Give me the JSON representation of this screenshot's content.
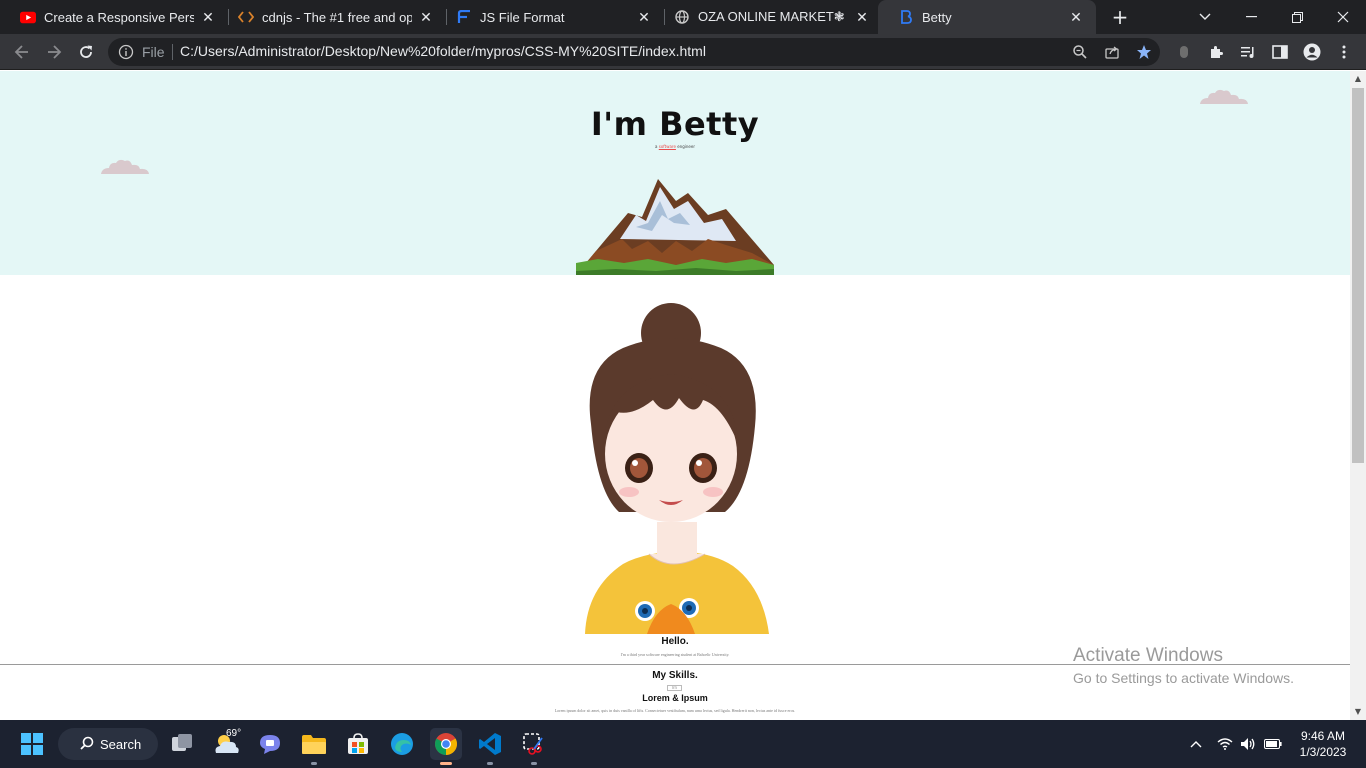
{
  "browser": {
    "tabs": [
      {
        "title": "Create a Responsive Personal",
        "favicon": "youtube-icon",
        "active": false
      },
      {
        "title": "cdnjs - The #1 free and open",
        "favicon": "code-brackets-icon",
        "active": false
      },
      {
        "title": "JS File Format",
        "favicon": "f-logo-icon",
        "active": false
      },
      {
        "title": "OZA ONLINE MARKET❃",
        "favicon": "globe-icon",
        "active": false
      },
      {
        "title": "Betty",
        "favicon": "bootstrap-b-icon",
        "active": true
      }
    ],
    "new_tab_label": "+",
    "address": {
      "scheme_label": "File",
      "url": "C:/Users/Administrator/Desktop/New%20folder/mypros/CSS-MY%20SITE/index.html"
    }
  },
  "page": {
    "hero": {
      "title": "I'm Betty",
      "subtitle_prefix": "a",
      "subtitle_highlight": "software",
      "subtitle_suffix": "engineer"
    },
    "about": {
      "heading": "Hello.",
      "text": "I'm a third year software engineering student at Bahcelir University."
    },
    "skills": {
      "heading": "My Skills.",
      "broken_image_alt": "lrn",
      "item_title": "Lorem & Ipsum",
      "item_text": "Lorem ipsum dolor sit amet, quis in duis vanilla of lifts. Consectetuer vestibulum, nam urna lectus, sed ligula. Hendrerit non, lectus ante id fusce eros."
    },
    "watermark": {
      "line1": "Activate Windows",
      "line2": "Go to Settings to activate Windows."
    }
  },
  "taskbar": {
    "search_label": "Search",
    "weather_temp": "69°",
    "time": "9:46 AM",
    "date": "1/3/2023",
    "apps": [
      "start-icon",
      "task-view-icon",
      "weather-icon",
      "teams-chat-icon",
      "file-explorer-icon",
      "microsoft-store-icon",
      "edge-icon",
      "chrome-icon",
      "vscode-icon",
      "snipping-tool-icon"
    ]
  },
  "colors": {
    "hero_bg": "#e4f7f6",
    "tab_bg": "#202124",
    "toolbar_bg": "#35363a",
    "taskbar_bg": "#1c2230",
    "accent_highlight": "#ea4c4c"
  }
}
